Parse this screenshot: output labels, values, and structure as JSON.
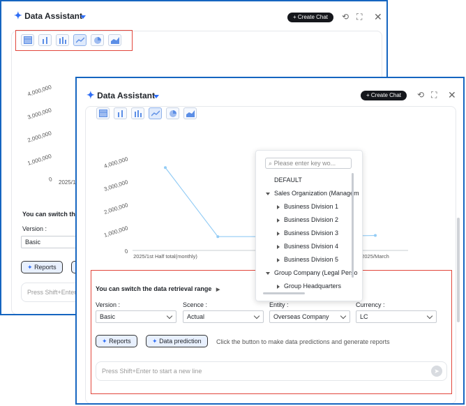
{
  "assistant": {
    "title": "Data Assistant",
    "create_chat": "+ Create Chat"
  },
  "chart_types": [
    "table",
    "bar",
    "grouped-bar",
    "line",
    "pie",
    "area"
  ],
  "active_chart_type": "line",
  "chart_data": {
    "type": "line",
    "x": [
      "2025/1st Half total(monthly)",
      "",
      "",
      "",
      "2025/March"
    ],
    "y": [
      3600000,
      600000,
      600000,
      620000,
      650000
    ],
    "y_ticks": [
      "0",
      "1,000,000",
      "2,000,000",
      "3,000,000",
      "4,000,000"
    ],
    "ylim": [
      0,
      4000000
    ],
    "color": "#93ccf5"
  },
  "back_chart": {
    "y_ticks": [
      "0",
      "1,000,000",
      "2,000,000",
      "3,000,000",
      "4,000,000"
    ],
    "x_label_partial": "2025/1st"
  },
  "range": {
    "heading": "You can switch the data retrieval range",
    "heading_partial": "You can switch the d",
    "version_label": "Version :",
    "scence_label": "Scence :",
    "entity_label": "Entity :",
    "currency_label": "Currency :",
    "version_value": "Basic",
    "scence_value": "Actual",
    "entity_value": "Overseas Company",
    "currency_value": "LC"
  },
  "actions": {
    "reports": "Reports",
    "prediction": "Data prediction",
    "hint": "Click the button to make data predictions and generate reports"
  },
  "composer": {
    "placeholder": "Press Shift+Enter to start a new line",
    "placeholder_partial": "Press Shift+Enter to"
  },
  "dropdown": {
    "search_placeholder": "Please enter key wo...",
    "items": [
      {
        "label": "DEFAULT",
        "level": 0,
        "arrow": "none"
      },
      {
        "label": "Sales Organization (Managem",
        "level": 0,
        "arrow": "down"
      },
      {
        "label": "Business Division 1",
        "level": 1,
        "arrow": "right"
      },
      {
        "label": "Business Division 2",
        "level": 1,
        "arrow": "right"
      },
      {
        "label": "Business Division 3",
        "level": 1,
        "arrow": "right"
      },
      {
        "label": "Business Division 4",
        "level": 1,
        "arrow": "right"
      },
      {
        "label": "Business Division 5",
        "level": 1,
        "arrow": "right"
      },
      {
        "label": "Group Company (Legal Perso",
        "level": 0,
        "arrow": "down"
      },
      {
        "label": "Group Headquarters",
        "level": 1,
        "arrow": "right"
      }
    ]
  },
  "colors": {
    "frame": "#1565c0",
    "accent": "#2f6ef5",
    "highlight": "#e2463b",
    "line": "#93ccf5"
  }
}
